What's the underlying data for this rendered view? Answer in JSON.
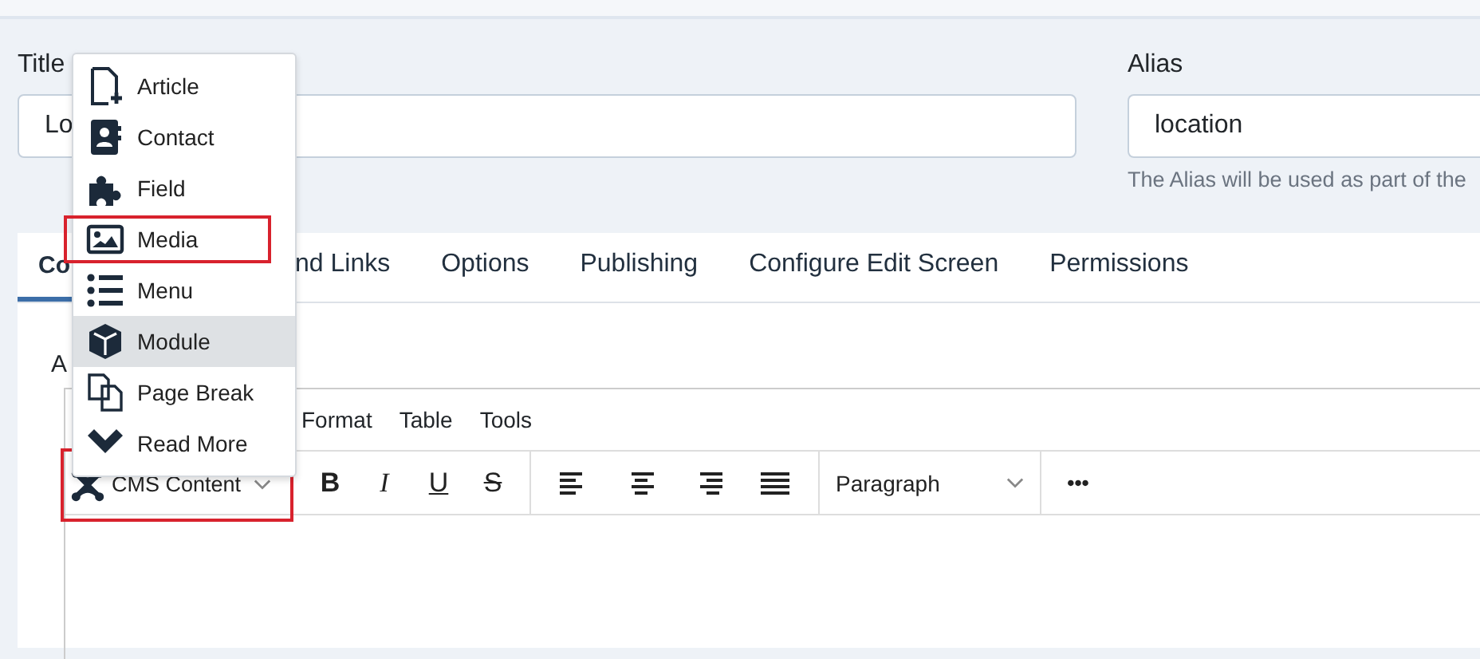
{
  "title_field": {
    "label": "Title",
    "value": "Lo"
  },
  "alias_field": {
    "label": "Alias",
    "value": "location",
    "hint": "The Alias will be used as part of the"
  },
  "tabs": [
    {
      "label": "Co",
      "selected": true
    },
    {
      "label": "nd Links",
      "selected": false
    },
    {
      "label": "Options",
      "selected": false
    },
    {
      "label": "Publishing",
      "selected": false
    },
    {
      "label": "Configure Edit Screen",
      "selected": false
    },
    {
      "label": "Permissions",
      "selected": false
    }
  ],
  "editor": {
    "label": "A",
    "menubar": [
      "Format",
      "Table",
      "Tools"
    ],
    "cms_button": {
      "label": "CMS Content",
      "annotated": true
    },
    "format_buttons": [
      "B",
      "I",
      "U",
      "S"
    ],
    "block_format": "Paragraph",
    "more": "•••"
  },
  "insert_menu": [
    {
      "label": "Article",
      "kind": "article",
      "hovered": false,
      "annotated": false
    },
    {
      "label": "Contact",
      "kind": "contact",
      "hovered": false,
      "annotated": false
    },
    {
      "label": "Field",
      "kind": "field",
      "hovered": false,
      "annotated": false
    },
    {
      "label": "Media",
      "kind": "media",
      "hovered": false,
      "annotated": true
    },
    {
      "label": "Menu",
      "kind": "menu",
      "hovered": false,
      "annotated": false
    },
    {
      "label": "Module",
      "kind": "module",
      "hovered": true,
      "annotated": false
    },
    {
      "label": "Page Break",
      "kind": "pagebreak",
      "hovered": false,
      "annotated": false
    },
    {
      "label": "Read More",
      "kind": "readmore",
      "hovered": false,
      "annotated": false
    }
  ]
}
